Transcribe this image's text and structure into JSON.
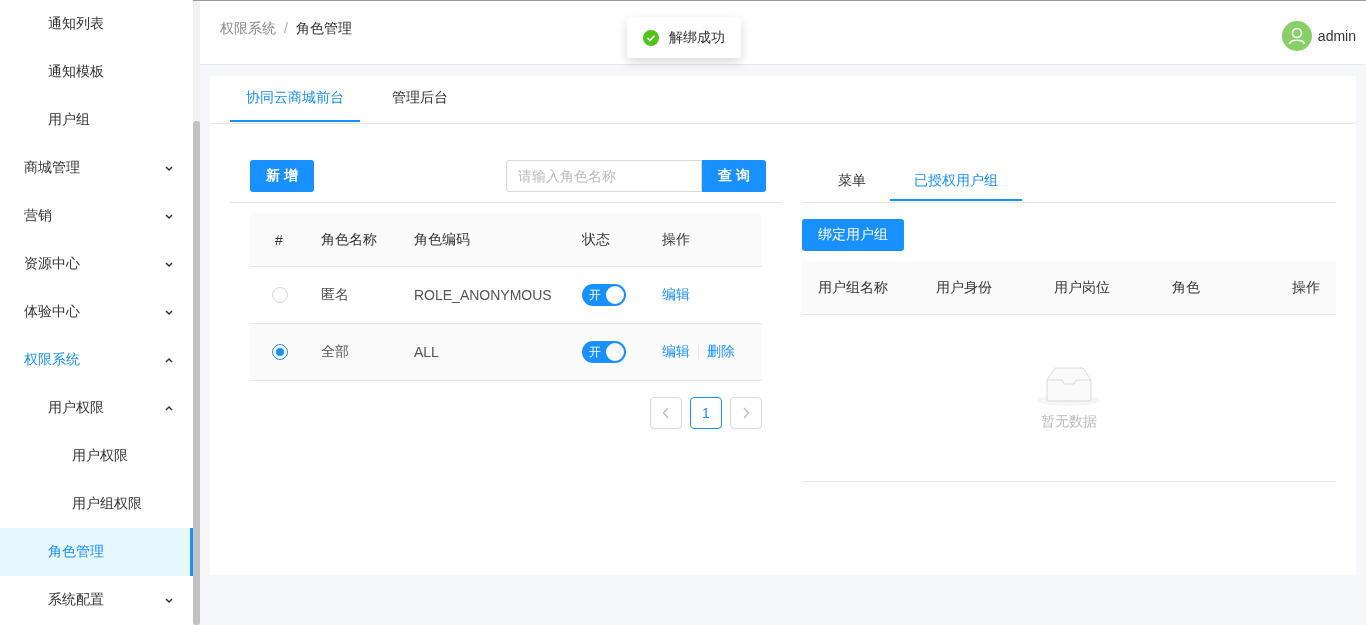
{
  "sidebar": {
    "continued_children": [
      {
        "label": "通知列表",
        "selected": false
      },
      {
        "label": "通知模板",
        "selected": false
      },
      {
        "label": "用户组",
        "selected": false
      }
    ],
    "items": [
      {
        "label": "商城管理",
        "selected": false,
        "expanded": false
      },
      {
        "label": "营销",
        "selected": false,
        "expanded": false
      },
      {
        "label": "资源中心",
        "selected": false,
        "expanded": false
      },
      {
        "label": "体验中心",
        "selected": false,
        "expanded": false
      },
      {
        "label": "权限系统",
        "selected": false,
        "expanded": true,
        "children": [
          {
            "label": "用户权限",
            "selected": false,
            "expanded": true,
            "children": [
              {
                "label": "用户权限",
                "selected": false
              },
              {
                "label": "用户组权限",
                "selected": false
              }
            ]
          },
          {
            "label": "角色管理",
            "selected": true
          },
          {
            "label": "系统配置",
            "selected": false,
            "expanded": false
          }
        ]
      }
    ]
  },
  "breadcrumb": [
    "权限系统",
    "角色管理"
  ],
  "breadcrumb_separator": "/",
  "toast": {
    "message": "解绑成功"
  },
  "user": {
    "name": "admin"
  },
  "tabs": [
    {
      "label": "协同云商城前台",
      "selected": true
    },
    {
      "label": "管理后台",
      "selected": false
    }
  ],
  "roles": {
    "add_button": "新 增",
    "search": {
      "placeholder": "请输入角色名称"
    },
    "search_button": "查 询",
    "columns": [
      "#",
      "角色名称",
      "角色编码",
      "状态",
      "操作"
    ],
    "rows": [
      {
        "selected": false,
        "name": "匿名",
        "code": "ROLE_ANONYMOUS",
        "status": {
          "on": true,
          "label": "开"
        },
        "actions": [
          "编辑"
        ]
      },
      {
        "selected": true,
        "name": "全部",
        "code": "ALL",
        "status": {
          "on": true,
          "label": "开"
        },
        "actions": [
          "编辑",
          "删除"
        ]
      }
    ],
    "pagination": {
      "pages": [
        {
          "label": "1",
          "selected": true
        }
      ]
    }
  },
  "detail": {
    "tabs": [
      {
        "label": "菜单",
        "selected": false
      },
      {
        "label": "已授权用户组",
        "selected": true
      }
    ],
    "bind_button": "绑定用户组",
    "columns": [
      "用户组名称",
      "用户身份",
      "用户岗位",
      "角色",
      "操作"
    ],
    "empty_text": "暂无数据"
  }
}
